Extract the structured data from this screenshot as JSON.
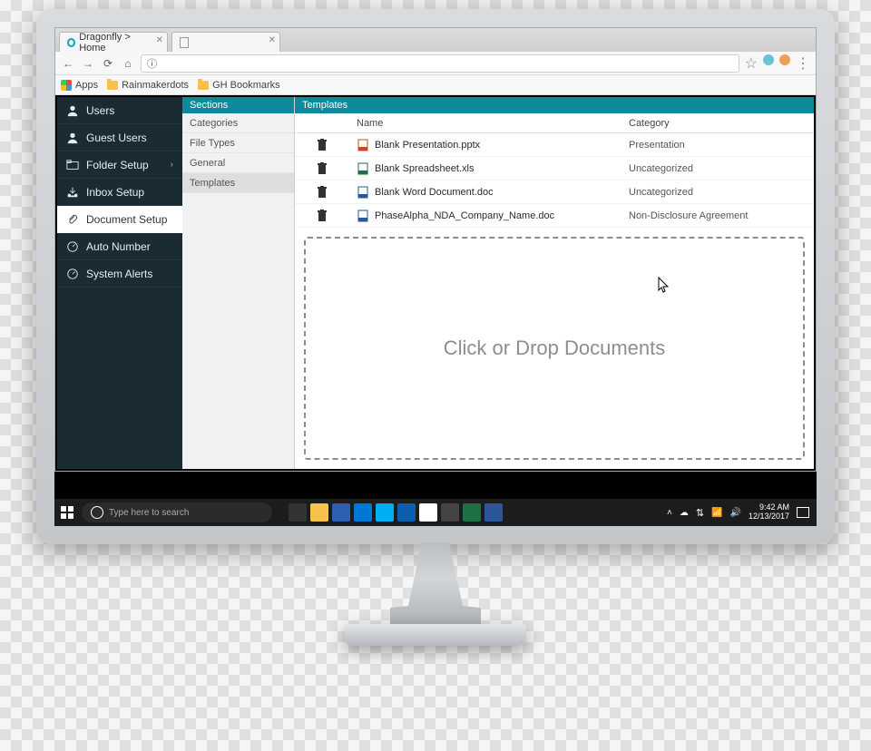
{
  "browser": {
    "tabs": [
      {
        "title": "Dragonfly > Home",
        "favicon": "teal"
      },
      {
        "title": "",
        "favicon": "blank"
      }
    ],
    "bookmarks_label": "Apps",
    "bookmarks": [
      {
        "label": "Rainmakerdots"
      },
      {
        "label": "GH Bookmarks"
      }
    ],
    "address_info": "ⓘ"
  },
  "sidebar": {
    "items": [
      {
        "label": "Users",
        "icon": "user"
      },
      {
        "label": "Guest Users",
        "icon": "user"
      },
      {
        "label": "Folder Setup",
        "icon": "folder",
        "chevron": true
      },
      {
        "label": "Inbox Setup",
        "icon": "inbox"
      },
      {
        "label": "Document Setup",
        "icon": "clip",
        "active": true
      },
      {
        "label": "Auto Number",
        "icon": "gauge"
      },
      {
        "label": "System Alerts",
        "icon": "gauge"
      }
    ]
  },
  "sections": {
    "header": "Sections",
    "items": [
      {
        "label": "Categories"
      },
      {
        "label": "File Types"
      },
      {
        "label": "General"
      },
      {
        "label": "Templates",
        "selected": true
      }
    ]
  },
  "templates": {
    "header": "Templates",
    "columns": {
      "name": "Name",
      "category": "Category"
    },
    "rows": [
      {
        "name": "Blank Presentation.pptx",
        "category": "Presentation",
        "ftype": "pptx"
      },
      {
        "name": "Blank Spreadsheet.xls",
        "category": "Uncategorized",
        "ftype": "xls"
      },
      {
        "name": "Blank Word Document.doc",
        "category": "Uncategorized",
        "ftype": "doc"
      },
      {
        "name": "PhaseAlpha_NDA_Company_Name.doc",
        "category": "Non-Disclosure Agreement",
        "ftype": "doc"
      }
    ],
    "dropzone_text": "Click or Drop Documents"
  },
  "taskbar": {
    "search_placeholder": "Type here to search",
    "time": "9:42 AM",
    "date": "12/13/2017",
    "apps": [
      {
        "name": "task-view",
        "bg": "#333"
      },
      {
        "name": "file-explorer",
        "bg": "#f6c24d"
      },
      {
        "name": "store",
        "bg": "#2d5fb3"
      },
      {
        "name": "edge",
        "bg": "#0078d7"
      },
      {
        "name": "skype",
        "bg": "#00aff0"
      },
      {
        "name": "outlook",
        "bg": "#0a5fb0"
      },
      {
        "name": "chrome",
        "bg": "#fff"
      },
      {
        "name": "photos",
        "bg": "#444"
      },
      {
        "name": "excel",
        "bg": "#1e7145"
      },
      {
        "name": "word",
        "bg": "#2b579a"
      }
    ]
  }
}
